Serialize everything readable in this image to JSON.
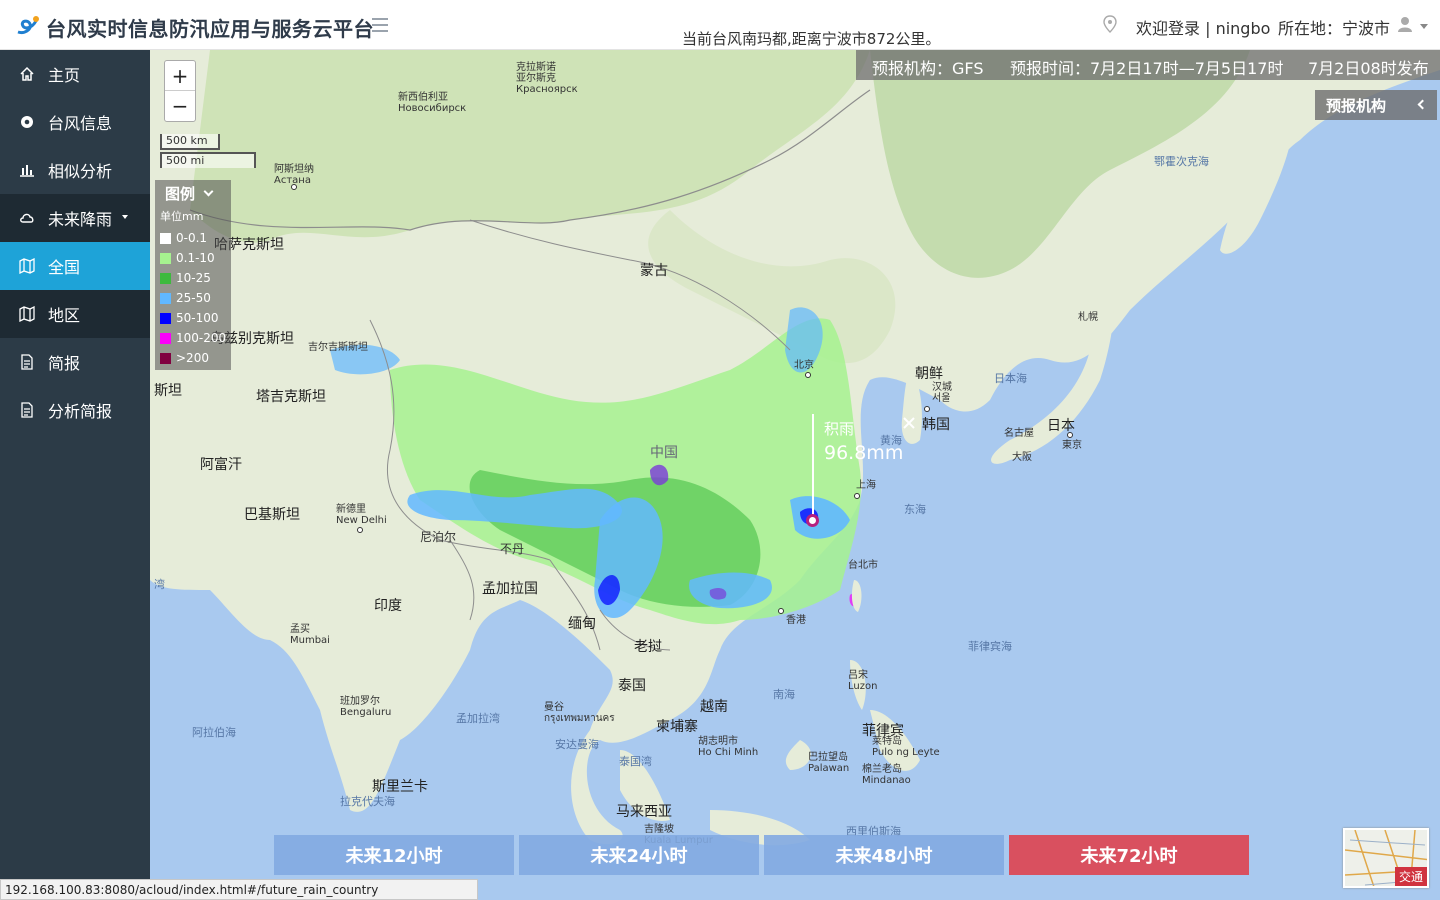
{
  "header": {
    "title": "台风实时信息防汛应用与服务云平台",
    "typhoon_status": "当前台风南玛都,距离宁波市872公里。",
    "welcome": "欢迎登录 | ningbo",
    "location": "所在地：宁波市"
  },
  "sidebar": {
    "items": [
      {
        "label": "主页",
        "icon": "home-icon"
      },
      {
        "label": "台风信息",
        "icon": "typhoon-icon"
      },
      {
        "label": "相似分析",
        "icon": "bar-chart-icon"
      },
      {
        "label": "未来降雨",
        "icon": "cloud-icon"
      },
      {
        "label": "全国",
        "icon": "map-icon"
      },
      {
        "label": "地区",
        "icon": "map-icon"
      },
      {
        "label": "简报",
        "icon": "document-icon"
      },
      {
        "label": "分析简报",
        "icon": "document-icon"
      }
    ]
  },
  "map": {
    "zoom_in": "+",
    "zoom_out": "−",
    "scale_km": "500 km",
    "scale_mi": "500 mi",
    "legend": {
      "title": "图例",
      "unit": "单位mm",
      "items": [
        {
          "label": "0-0.1",
          "color": "#ffffff"
        },
        {
          "label": "0.1-10",
          "color": "#a6f28f"
        },
        {
          "label": "10-25",
          "color": "#3dba3d"
        },
        {
          "label": "25-50",
          "color": "#61b8ff"
        },
        {
          "label": "50-100",
          "color": "#0000ff"
        },
        {
          "label": "100-200",
          "color": "#fa00fa"
        },
        {
          "label": ">200",
          "color": "#800040"
        }
      ]
    },
    "forecast": {
      "agency": "预报机构：GFS",
      "period": "预报时间：7月2日17时—7月5日17时",
      "issued": "7月2日08时发布"
    },
    "agency_panel": "预报机构",
    "rain_marker": {
      "title": "积雨",
      "value": "96.8mm"
    },
    "labels": {
      "mongolia": "蒙古",
      "china": "中国",
      "kazakhstan": "哈萨克斯坦",
      "uzbekistan": "乌兹别克斯坦",
      "kyrgyzstan": "吉尔吉斯斯坦",
      "tajikistan": "塔吉克斯坦",
      "afghanistan": "阿富汗",
      "pakistan": "巴基斯坦",
      "india": "印度",
      "nepal": "尼泊尔",
      "bhutan": "不丹",
      "bangladesh": "孟加拉国",
      "myanmar": "缅甸",
      "laos": "老挝",
      "thailand": "泰国",
      "vietnam": "越南",
      "cambodia": "柬埔寨",
      "malaysia": "马来西亚",
      "sri_lanka": "斯里兰卡",
      "philippines": "菲律宾",
      "north_korea": "朝鲜",
      "south_korea": "韩国",
      "japan": "日本",
      "turkmen": "斯坦",
      "sea_japan": "日本海",
      "sea_yellow": "黄海",
      "sea_east": "东海",
      "sea_south": "南海",
      "sea_philippine": "菲律宾海",
      "sea_okhotsk": "鄂霍次克海",
      "sea_bengal": "孟加拉湾",
      "sea_arabian": "阿拉伯海",
      "sea_andaman": "安达曼海",
      "sea_thailand": "泰国湾",
      "sea_laccadive": "拉克代夫海",
      "sea_celebes": "西里伯斯海",
      "sea_gulf": "湾",
      "city_krasnoyarsk": "克拉斯诺\n亚尔斯克\nКрасноярск",
      "city_novosibirsk": "新西伯利亚\nНовосибирск",
      "city_astana": "阿斯坦纳\nАстана",
      "city_beijing": "北京",
      "city_shanghai": "上海",
      "city_taipei": "台北市",
      "city_hongkong": "香港",
      "city_seoul": "汉城\n서울",
      "city_tokyo": "東京",
      "city_nagoya": "名古屋",
      "city_osaka": "大阪",
      "city_sapporo": "札幌",
      "city_newdelhi": "新德里\nNew Delhi",
      "city_mumbai": "孟买\nMumbai",
      "city_bengaluru": "班加罗尔\nBengaluru",
      "city_bangkok": "曼谷\nกรุงเทพมหานคร",
      "city_hcm": "胡志明市\nHo Chi Minh",
      "city_kl": "吉隆坡\nKuala Lumpur",
      "city_luzon": "吕宋\nLuzon",
      "city_leyte": "莱特岛\nPulo ng Leyte",
      "city_palawan": "巴拉望岛\nPalawan",
      "city_mindanao": "棉兰老岛\nMindanao"
    }
  },
  "tabs": [
    {
      "label": "未来12小时",
      "active": false
    },
    {
      "label": "未来24小时",
      "active": false
    },
    {
      "label": "未来48小时",
      "active": false
    },
    {
      "label": "未来72小时",
      "active": true
    }
  ],
  "minimap": {
    "label": "交通"
  },
  "statusbar": {
    "url": "192.168.100.83:8080/acloud/index.html#/future_rain_country"
  },
  "colors": {
    "sidebar": "#2c3b47",
    "sidebar_active": "#1ea3d8",
    "tab_active": "#d9505f",
    "tab": "#82aae1"
  }
}
